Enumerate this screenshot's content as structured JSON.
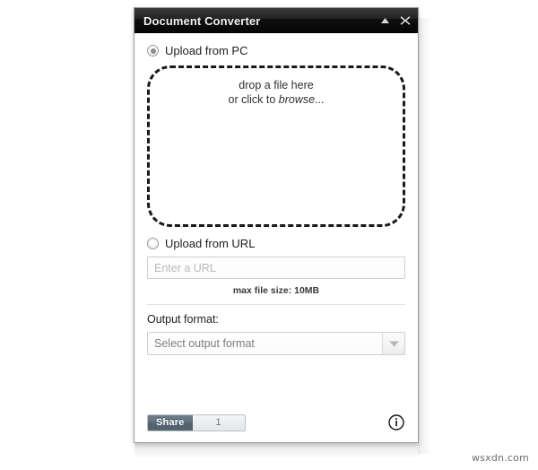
{
  "window": {
    "title": "Document Converter",
    "collapse_icon": "triangle-up-icon",
    "close_icon": "close-icon"
  },
  "upload_pc": {
    "radio_label": "Upload from PC",
    "selected": true,
    "dropzone": {
      "line1": "drop a file here",
      "line2_prefix": "or click to ",
      "line2_emphasis": "browse",
      "line2_suffix": "..."
    }
  },
  "upload_url": {
    "radio_label": "Upload from URL",
    "selected": false,
    "input_value": "",
    "input_placeholder": "Enter a URL",
    "max_file_size": "max file size: 10MB"
  },
  "output": {
    "label": "Output format:",
    "selected_text": "Select output format",
    "arrow_icon": "chevron-down-icon"
  },
  "footer": {
    "share_label": "Share",
    "share_count": "1",
    "info_icon": "info-circle-icon"
  },
  "watermark": {
    "text": "wsxdn.com"
  },
  "colors": {
    "titlebar": "#121212",
    "dropzone_border": "#191919",
    "share_button": "#5d6d7a",
    "text_primary": "#1d1d1d",
    "text_muted": "#7c7c7c"
  }
}
